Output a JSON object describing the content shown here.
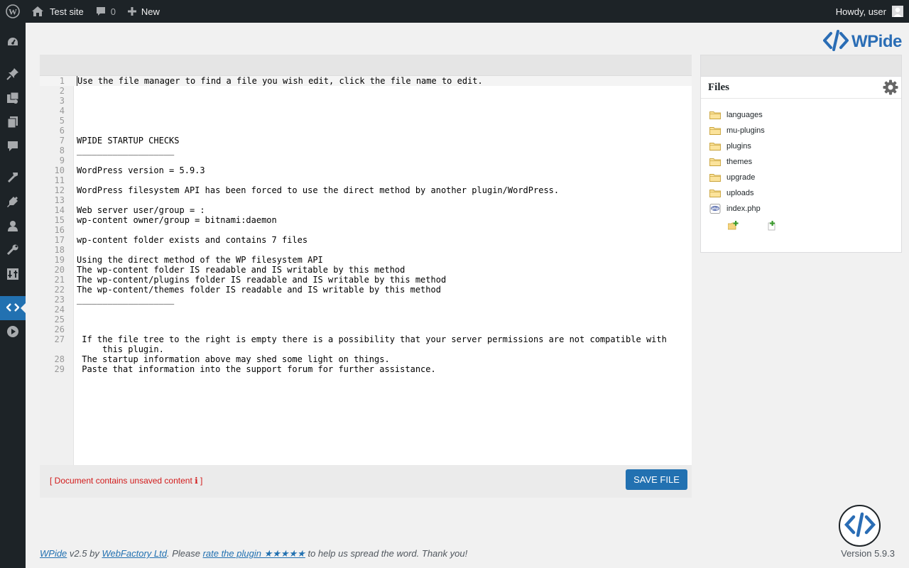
{
  "adminbar": {
    "site_name": "Test site",
    "comments_count": "0",
    "new_label": "New",
    "howdy": "Howdy, user"
  },
  "adminmenu": {
    "items": [
      {
        "icon": "dashboard-icon",
        "current": false
      },
      {
        "icon": "pin-icon",
        "current": false
      },
      {
        "icon": "media-icon",
        "current": false
      },
      {
        "icon": "pages-icon",
        "current": false
      },
      {
        "icon": "comments-icon",
        "current": false
      },
      {
        "icon": "appearance-icon",
        "current": false
      },
      {
        "icon": "plugins-icon",
        "current": false
      },
      {
        "icon": "users-icon",
        "current": false
      },
      {
        "icon": "tools-icon",
        "current": false
      },
      {
        "icon": "settings-icon",
        "current": false
      },
      {
        "icon": "code-icon",
        "current": true
      },
      {
        "icon": "play-icon",
        "current": false
      }
    ]
  },
  "logo": {
    "text": "WPide"
  },
  "editor": {
    "lines": [
      {
        "n": "1",
        "t": "Use the file manager to find a file you wish edit, click the file name to edit."
      },
      {
        "n": "2",
        "t": ""
      },
      {
        "n": "3",
        "t": ""
      },
      {
        "n": "4",
        "t": ""
      },
      {
        "n": "5",
        "t": ""
      },
      {
        "n": "6",
        "t": ""
      },
      {
        "n": "7",
        "t": "WPIDE STARTUP CHECKS"
      },
      {
        "n": "8",
        "t": "___________________"
      },
      {
        "n": "9",
        "t": ""
      },
      {
        "n": "10",
        "t": "WordPress version = 5.9.3"
      },
      {
        "n": "11",
        "t": ""
      },
      {
        "n": "12",
        "t": "WordPress filesystem API has been forced to use the direct method by another plugin/WordPress."
      },
      {
        "n": "13",
        "t": ""
      },
      {
        "n": "14",
        "t": "Web server user/group = :"
      },
      {
        "n": "15",
        "t": "wp-content owner/group = bitnami:daemon"
      },
      {
        "n": "16",
        "t": ""
      },
      {
        "n": "17",
        "t": "wp-content folder exists and contains 7 files"
      },
      {
        "n": "18",
        "t": ""
      },
      {
        "n": "19",
        "t": "Using the direct method of the WP filesystem API"
      },
      {
        "n": "20",
        "t": "The wp-content folder IS readable and IS writable by this method"
      },
      {
        "n": "21",
        "t": "The wp-content/plugins folder IS readable and IS writable by this method"
      },
      {
        "n": "22",
        "t": "The wp-content/themes folder IS readable and IS writable by this method"
      },
      {
        "n": "23",
        "t": "___________________"
      },
      {
        "n": "24",
        "t": ""
      },
      {
        "n": "25",
        "t": ""
      },
      {
        "n": "26",
        "t": ""
      },
      {
        "n": "27",
        "t": " If the file tree to the right is empty there is a possibility that your server permissions are not compatible with\n     this plugin."
      },
      {
        "n": "28",
        "t": " The startup information above may shed some light on things."
      },
      {
        "n": "29",
        "t": " Paste that information into the support forum for further assistance."
      }
    ],
    "unsaved_notice": "[ Document contains unsaved content ℹ ]",
    "save_label": "SAVE FILE"
  },
  "files": {
    "title": "Files",
    "items": [
      {
        "name": "languages",
        "type": "folder"
      },
      {
        "name": "mu-plugins",
        "type": "folder"
      },
      {
        "name": "plugins",
        "type": "folder"
      },
      {
        "name": "themes",
        "type": "folder"
      },
      {
        "name": "upgrade",
        "type": "folder"
      },
      {
        "name": "uploads",
        "type": "folder"
      },
      {
        "name": "index.php",
        "type": "php-file"
      }
    ]
  },
  "footer": {
    "plugin_link": "WPide",
    "by_text": " v2.5 by ",
    "company_link": "WebFactory Ltd",
    "please_text": ". Please ",
    "rate_link": "rate the plugin ★★★★★",
    "thanks_text": " to help us spread the word. Thank you!",
    "version": "Version 5.9.3"
  },
  "colors": {
    "accent": "#2271b1",
    "admin_dark": "#1d2327",
    "unsaved_red": "#d21b1b",
    "logo_blue": "#2a6db5"
  }
}
